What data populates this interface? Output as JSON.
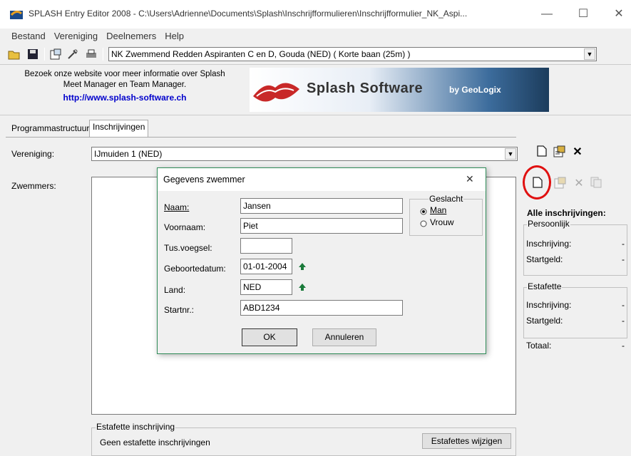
{
  "window": {
    "title": "SPLASH Entry Editor 2008 - C:\\Users\\Adrienne\\Documents\\Splash\\Inschrijfformulieren\\Inschrijfformulier_NK_Aspi...",
    "minimize": "—",
    "maximize": "☐",
    "close": "✕"
  },
  "menu": {
    "items": [
      "Bestand",
      "Vereniging",
      "Deelnemers",
      "Help"
    ]
  },
  "toolbar": {
    "meet_combo": "NK Zwemmend Redden Aspiranten C en D,  Gouda  (NED)  ( Korte baan (25m) )"
  },
  "banner": {
    "line1": "Bezoek onze website voor meer informatie over Splash",
    "line2": "Meet Manager en Team Manager.",
    "link": "http://www.splash-software.ch",
    "brand": "Splash Software",
    "by": "by GeoLogix"
  },
  "tabs": [
    "Programmastructuur",
    "Inschrijvingen"
  ],
  "main": {
    "vereniging_label": "Vereniging:",
    "vereniging_value": "IJmuiden 1 (NED)",
    "zwemmers_label": "Zwemmers:",
    "estafette_group": "Estafette inschrijving",
    "estafette_text": "Geen estafette inschrijvingen",
    "estafette_button": "Estafettes wijzigen"
  },
  "right_panel": {
    "alle": "Alle inschrijvingen:",
    "persoonlijk": "Persoonlijk",
    "inschrijving": "Inschrijving:",
    "startgeld": "Startgeld:",
    "estafette": "Estafette",
    "inschrijving2": "Inschrijving:",
    "startgeld2": "Startgeld:",
    "totaal": "Totaal:",
    "dash": "-"
  },
  "dialog": {
    "title": "Gegevens zwemmer",
    "close": "✕",
    "naam_label": "Naam:",
    "naam_value": "Jansen",
    "voornaam_label": "Voornaam:",
    "voornaam_value": "Piet",
    "tusvoegsel_label": "Tus.voegsel:",
    "tusvoegsel_value": "",
    "geboortedatum_label": "Geboortedatum:",
    "geboortedatum_value": "01-01-2004",
    "land_label": "Land:",
    "land_value": "NED",
    "startnr_label": "Startnr.:",
    "startnr_value": "ABD1234",
    "geslacht_label": "Geslacht",
    "man_label": "Man",
    "vrouw_label": "Vrouw",
    "geslacht_selected": "Man",
    "ok_label": "OK",
    "cancel_label": "Annuleren"
  },
  "colors": {
    "dialog_border": "#2e8b57",
    "highlight_circle": "#e01010",
    "link": "#0000cc"
  }
}
